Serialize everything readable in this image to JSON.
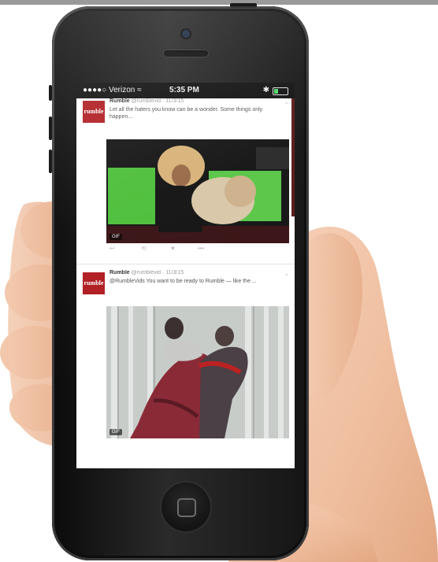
{
  "status_bar": {
    "carrier": "●●●●○ Verizon ≈",
    "time": "5:35 PM",
    "bluetooth": "✱",
    "battery_level": 0.3
  },
  "tweets": [
    {
      "author": "Rumble",
      "handle": "@rumblevid",
      "time": "· 11/3/15",
      "text": "Let all the haters you know can be a wonder. Some things only happen...",
      "avatar_text": "rumble",
      "media_badge": "GIF"
    },
    {
      "author": "Rumble",
      "handle": "@rumblevid",
      "time": "· 11/3/15",
      "text": "@RumbleVids You want to be ready to Rumble — like the ...",
      "avatar_text": "rumble",
      "media_badge": "GIF"
    }
  ],
  "actions": {
    "reply_icon": "reply-icon",
    "retweet_icon": "retweet-icon",
    "like_icon": "heart-icon",
    "more_icon": "more-icon",
    "reply": "↩",
    "retweet": "⟲",
    "like": "♥",
    "more": "•••"
  },
  "colors": {
    "avatar_bg": "#b01e23",
    "screen_bg": "#ffffff",
    "green_screen": "#4fbf3c"
  }
}
